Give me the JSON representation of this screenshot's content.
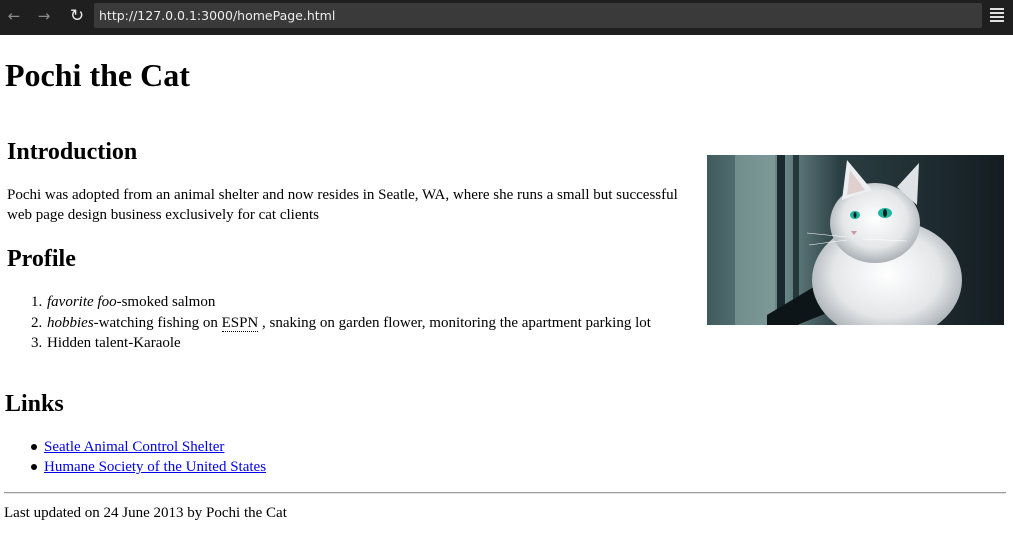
{
  "browser": {
    "back_icon": "←",
    "forward_icon": "→",
    "reload_icon": "↻",
    "url": "http://127.0.0.1:3000/homePage.html"
  },
  "page": {
    "title": "Pochi the Cat",
    "intro": {
      "heading": "Introduction",
      "text": "Pochi was adopted from an animal shelter and now resides in Seatle, WA, where she runs a small but successful web page design business exclusively for cat clients"
    },
    "photo": {
      "subject": "white fluffy cat with green eyes looking out a window"
    },
    "profile": {
      "heading": "Profile",
      "items": [
        {
          "num": "1.",
          "term": "favorite foo",
          "text": "-smoked salmon"
        },
        {
          "num": "2.",
          "term": "hobbies",
          "text_before": "-watching fishing on ",
          "abbr": "ESPN",
          "text_after": " , snaking on garden flower, monitoring the apartment parking lot"
        },
        {
          "num": "3.",
          "text": "Hidden talent-Karaole"
        }
      ]
    },
    "links": {
      "heading": "Links",
      "items": [
        {
          "label": "Seatle Animal Control Shelter"
        },
        {
          "label": "Humane Society of the United States"
        }
      ]
    },
    "footer": "Last updated on 24 June 2013 by Pochi the Cat"
  },
  "colors": {
    "chrome": "#1f1f1f",
    "urlbar": "#3a3a3a",
    "link": "#0000ee"
  }
}
